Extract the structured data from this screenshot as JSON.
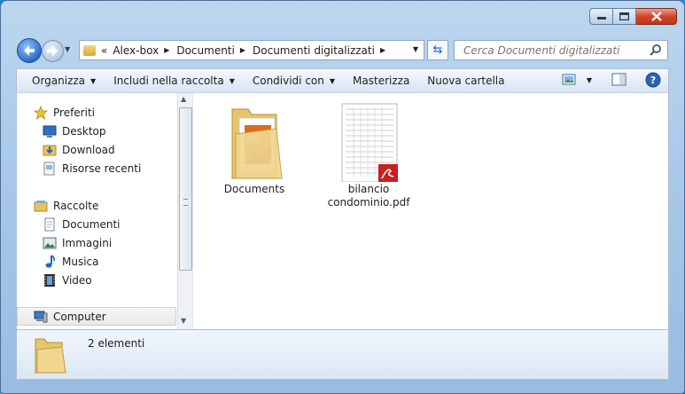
{
  "window": {
    "controls": {
      "minimize_icon": "minimize-icon",
      "maximize_icon": "maximize-icon",
      "close_icon": "close-icon"
    }
  },
  "address": {
    "breadcrumbs": [
      "Alex-box",
      "Documenti",
      "Documenti digitalizzati"
    ],
    "overflow_marker": "«"
  },
  "search": {
    "placeholder": "Cerca Documenti digitalizzati"
  },
  "toolbar": {
    "organize": "Organizza",
    "include": "Includi nella raccolta",
    "share": "Condividi con",
    "burn": "Masterizza",
    "new_folder": "Nuova cartella"
  },
  "sidebar": {
    "favorites_header": "Preferiti",
    "favorites": [
      "Desktop",
      "Download",
      "Risorse recenti"
    ],
    "libraries_header": "Raccolte",
    "libraries": [
      "Documenti",
      "Immagini",
      "Musica",
      "Video"
    ],
    "computer": "Computer"
  },
  "files": [
    {
      "name": "Documents",
      "type": "folder"
    },
    {
      "name": "bilancio condominio.pdf",
      "type": "pdf"
    }
  ],
  "status": {
    "count": "2 elementi"
  },
  "colors": {
    "accent": "#1d5fb1",
    "close_red": "#c2351b",
    "pdf_red": "#c8201e"
  }
}
